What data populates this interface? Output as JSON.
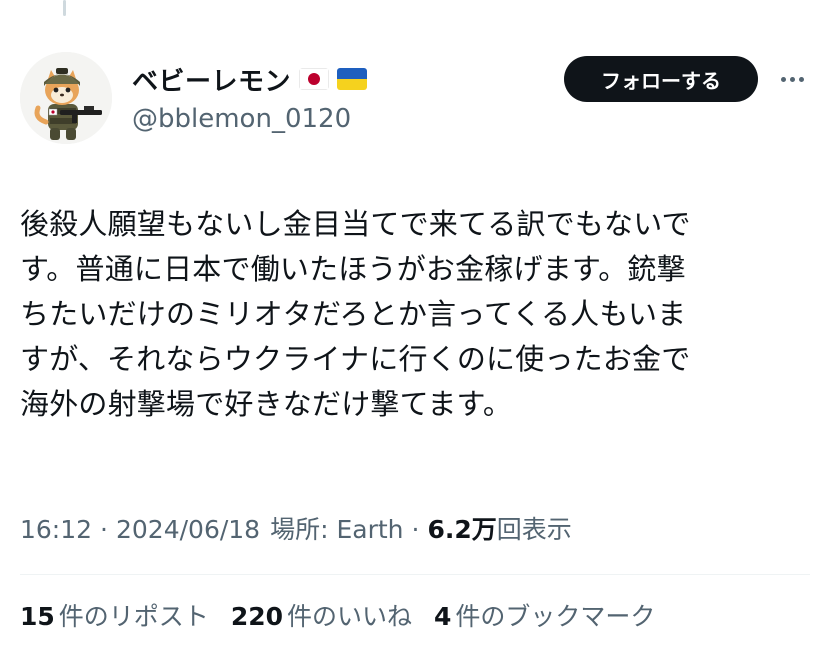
{
  "user": {
    "display_name": "ベビーレモン",
    "handle": "@bblemon_0120",
    "flags": [
      "japan-flag",
      "ukraine-flag"
    ]
  },
  "follow_label": "フォローする",
  "tweet": {
    "text": "後殺人願望もないし金目当てで来てる訳でもないで\nす。普通に日本で働いたほうがお金稼げます。銃撃\nちたいだけのミリオタだろとか言ってくる人もいま\nすが、それならウクライナに行くのに使ったお金で\n海外の射撃場で好きなだけ撃てます。"
  },
  "meta": {
    "time": "16:12",
    "date": "2024/06/18",
    "location": "場所: Earth",
    "views_count": "6.2万",
    "views_label": "回表示",
    "separator": "·"
  },
  "stats": [
    {
      "count": "15",
      "label": "件のリポスト"
    },
    {
      "count": "220",
      "label": "件のいいね"
    },
    {
      "count": "4",
      "label": "件のブックマーク"
    }
  ],
  "colors": {
    "text": "#0f1419",
    "secondary": "#536471",
    "button_bg": "#0f1419",
    "divider": "#eff3f4"
  }
}
